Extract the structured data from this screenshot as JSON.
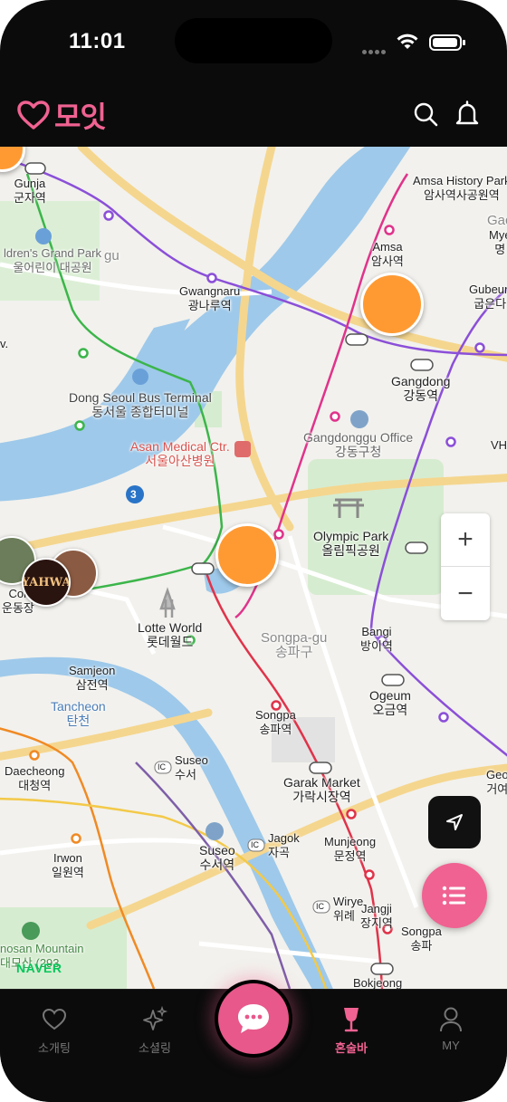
{
  "status": {
    "time": "11:01"
  },
  "header": {
    "logo_text": "모잇",
    "search_icon": "search-icon",
    "bell_icon": "bell-icon"
  },
  "map": {
    "labels": {
      "gunja_en": "Gunja",
      "gunja_kr": "군자역",
      "childrens_park_en": "ldren's Grand Park",
      "childrens_park_kr": "울어린이 대공원",
      "gu_partial": "gu",
      "gwangnaru_en": "Gwangnaru",
      "gwangnaru_kr": "광나루역",
      "amsa_history_en": "Amsa History Park",
      "amsa_history_kr": "암사역사공원역",
      "gac_partial": "Gac",
      "mye_partial": "Mye",
      "myeong_partial": "명",
      "amsa_en": "Amsa",
      "amsa_kr": "암사역",
      "gubeun_en": "Gubeun",
      "gubeun_kr": "굽은다",
      "v_partial": "v.",
      "dong_seoul_en": "Dong Seoul Bus Terminal",
      "dong_seoul_kr": "동서울 종합터미널",
      "gangdong_en": "Gangdong",
      "gangdong_kr": "강동역",
      "gangdonggu_office_en": "Gangdonggu Office",
      "gangdonggu_office_kr": "강동구청",
      "asan_en": "Asan Medical Ctr.",
      "asan_kr": "서울아산병원",
      "vhs_partial": "VHS",
      "road_number": "3",
      "olympic_en": "Olympic Park",
      "olympic_kr": "올림픽공원",
      "cor_partial": "Cor",
      "undong_partial": "운동장",
      "lotte_en": "Lotte World",
      "lotte_kr": "롯데월드",
      "songpa_gu_en": "Songpa-gu",
      "songpa_gu_kr": "송파구",
      "bangi_en": "Bangi",
      "bangi_kr": "방이역",
      "samjeon_en": "Samjeon",
      "samjeon_kr": "삼전역",
      "ogeum_en": "Ogeum",
      "ogeum_kr": "오금역",
      "tancheon_en": "Tancheon",
      "tancheon_kr": "탄천",
      "songpa_en": "Songpa",
      "songpa_kr": "송파역",
      "geo_partial": "Geo",
      "geo_kr_partial": "거여",
      "daecheong_en": "Daecheong",
      "daecheong_kr": "대청역",
      "suseo_ic_en": "Suseo",
      "suseo_ic_kr": "수서",
      "garak_en": "Garak Market",
      "garak_kr": "가락시장역",
      "ic1": "IC",
      "ic2": "IC",
      "ic3": "IC",
      "jagok_en": "Jagok",
      "jagok_kr": "자곡",
      "munjeong_en": "Munjeong",
      "munjeong_kr": "문정역",
      "suseo_en": "Suseo",
      "suseo_kr": "수서역",
      "irwon_en": "Irwon",
      "irwon_kr": "일원역",
      "wirye_en": "Wirye",
      "wirye_kr": "위례",
      "jangji_en": "Jangji",
      "jangji_kr": "장지역",
      "songpa2_en": "Songpa",
      "songpa2_kr": "송파",
      "mountain_en": "nosan Mountain",
      "mountain_kr": "대모산 (293",
      "bokjeong_en": "Bokjeong",
      "yahwa": "YAHWA"
    },
    "attribution": "NAVER",
    "zoom_in": "+",
    "zoom_out": "−"
  },
  "tabs": [
    {
      "label": "소개팅",
      "icon": "heart-icon"
    },
    {
      "label": "소셜링",
      "icon": "sparkle-icon"
    },
    {
      "label": "혼술바",
      "icon": "wine-glass-icon",
      "active": true
    },
    {
      "label": "MY",
      "icon": "person-icon"
    }
  ],
  "colors": {
    "accent": "#f06292",
    "marker": "#ff9a33",
    "river": "#9ec9ea",
    "line_red": "#e0334a",
    "line_purple": "#8b4fd8",
    "line_green": "#3bb54a",
    "line_pink": "#e0338b",
    "line_orange": "#f08a24"
  }
}
